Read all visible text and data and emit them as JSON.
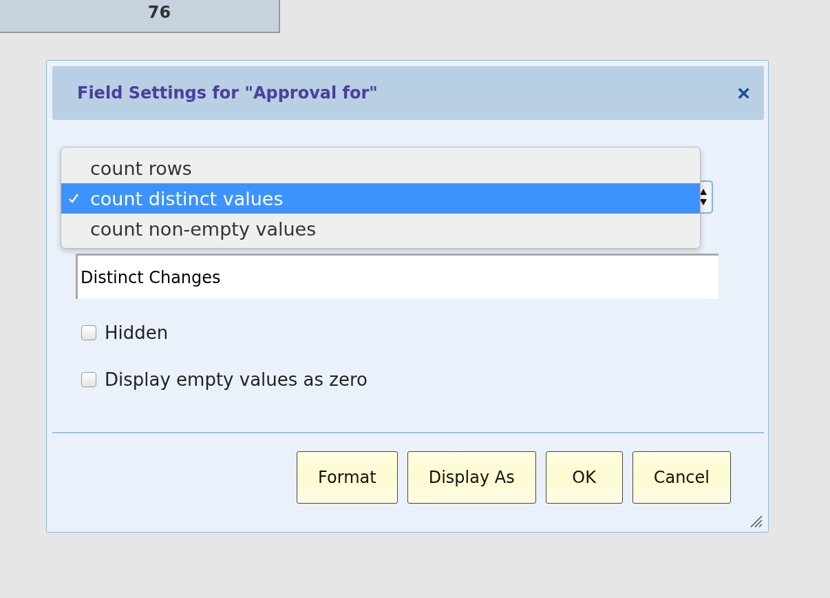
{
  "header_cell": {
    "value": "76"
  },
  "dialog": {
    "title": "Field Settings for \"Approval for\"",
    "close": "×",
    "aggregate_menu": {
      "options": [
        {
          "label": "count rows",
          "selected": false
        },
        {
          "label": "count distinct values",
          "selected": true
        },
        {
          "label": "count non-empty values",
          "selected": false
        }
      ]
    },
    "name_field": {
      "value": "Distinct Changes"
    },
    "checkboxes": [
      {
        "label": "Hidden",
        "checked": false
      },
      {
        "label": "Display empty values as zero",
        "checked": false
      }
    ],
    "buttons": [
      "Format",
      "Display As",
      "OK",
      "Cancel"
    ]
  }
}
